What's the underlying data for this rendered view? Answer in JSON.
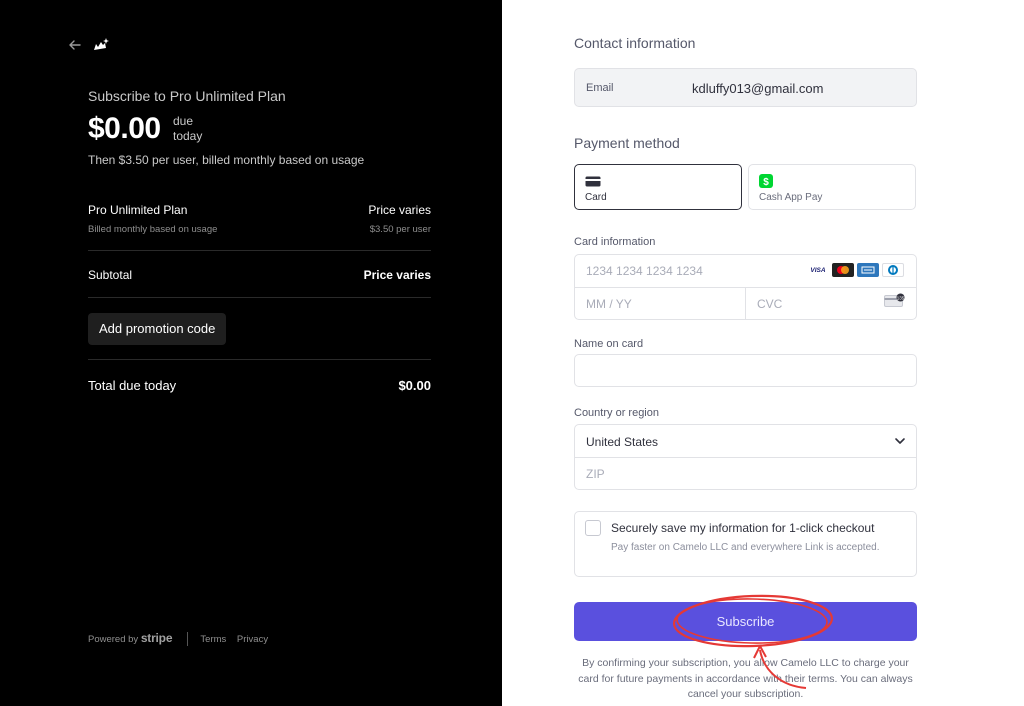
{
  "summary": {
    "subtitle": "Subscribe to Pro Unlimited Plan",
    "price": "$0.00",
    "due_line1": "due",
    "due_line2": "today",
    "then_text": "Then $3.50 per user, billed monthly based on usage",
    "plan_name": "Pro Unlimited Plan",
    "plan_price": "Price varies",
    "plan_billing": "Billed monthly based on usage",
    "plan_unit_price": "$3.50 per user",
    "subtotal_label": "Subtotal",
    "subtotal_value": "Price varies",
    "promo_button": "Add promotion code",
    "total_label": "Total due today",
    "total_value": "$0.00"
  },
  "footer": {
    "powered_by": "Powered by",
    "stripe": "stripe",
    "terms": "Terms",
    "privacy": "Privacy"
  },
  "form": {
    "contact_title": "Contact information",
    "email_label": "Email",
    "email_value": "kdluffy013@gmail.com",
    "payment_title": "Payment method",
    "methods": [
      {
        "label": "Card",
        "icon": "card-icon",
        "selected": true
      },
      {
        "label": "Cash App Pay",
        "icon": "cash-app-icon",
        "selected": false
      }
    ],
    "card_info_label": "Card information",
    "card_number_placeholder": "1234 1234 1234 1234",
    "expiry_placeholder": "MM / YY",
    "cvc_placeholder": "CVC",
    "brands": [
      "VISA",
      "mastercard",
      "amex",
      "diners"
    ],
    "name_label": "Name on card",
    "name_value": "",
    "country_label": "Country or region",
    "country_value": "United States",
    "zip_placeholder": "ZIP",
    "save_title": "Securely save my information for 1-click checkout",
    "save_sub": "Pay faster on Camelo LLC and everywhere Link is accepted.",
    "subscribe_button": "Subscribe",
    "terms_text": "By confirming your subscription, you allow Camelo LLC to charge your card for future payments in accordance with their terms. You can always cancel your subscription."
  },
  "colors": {
    "left_bg": "#000000",
    "accent": "#5a50de",
    "annotation": "#e53935"
  }
}
